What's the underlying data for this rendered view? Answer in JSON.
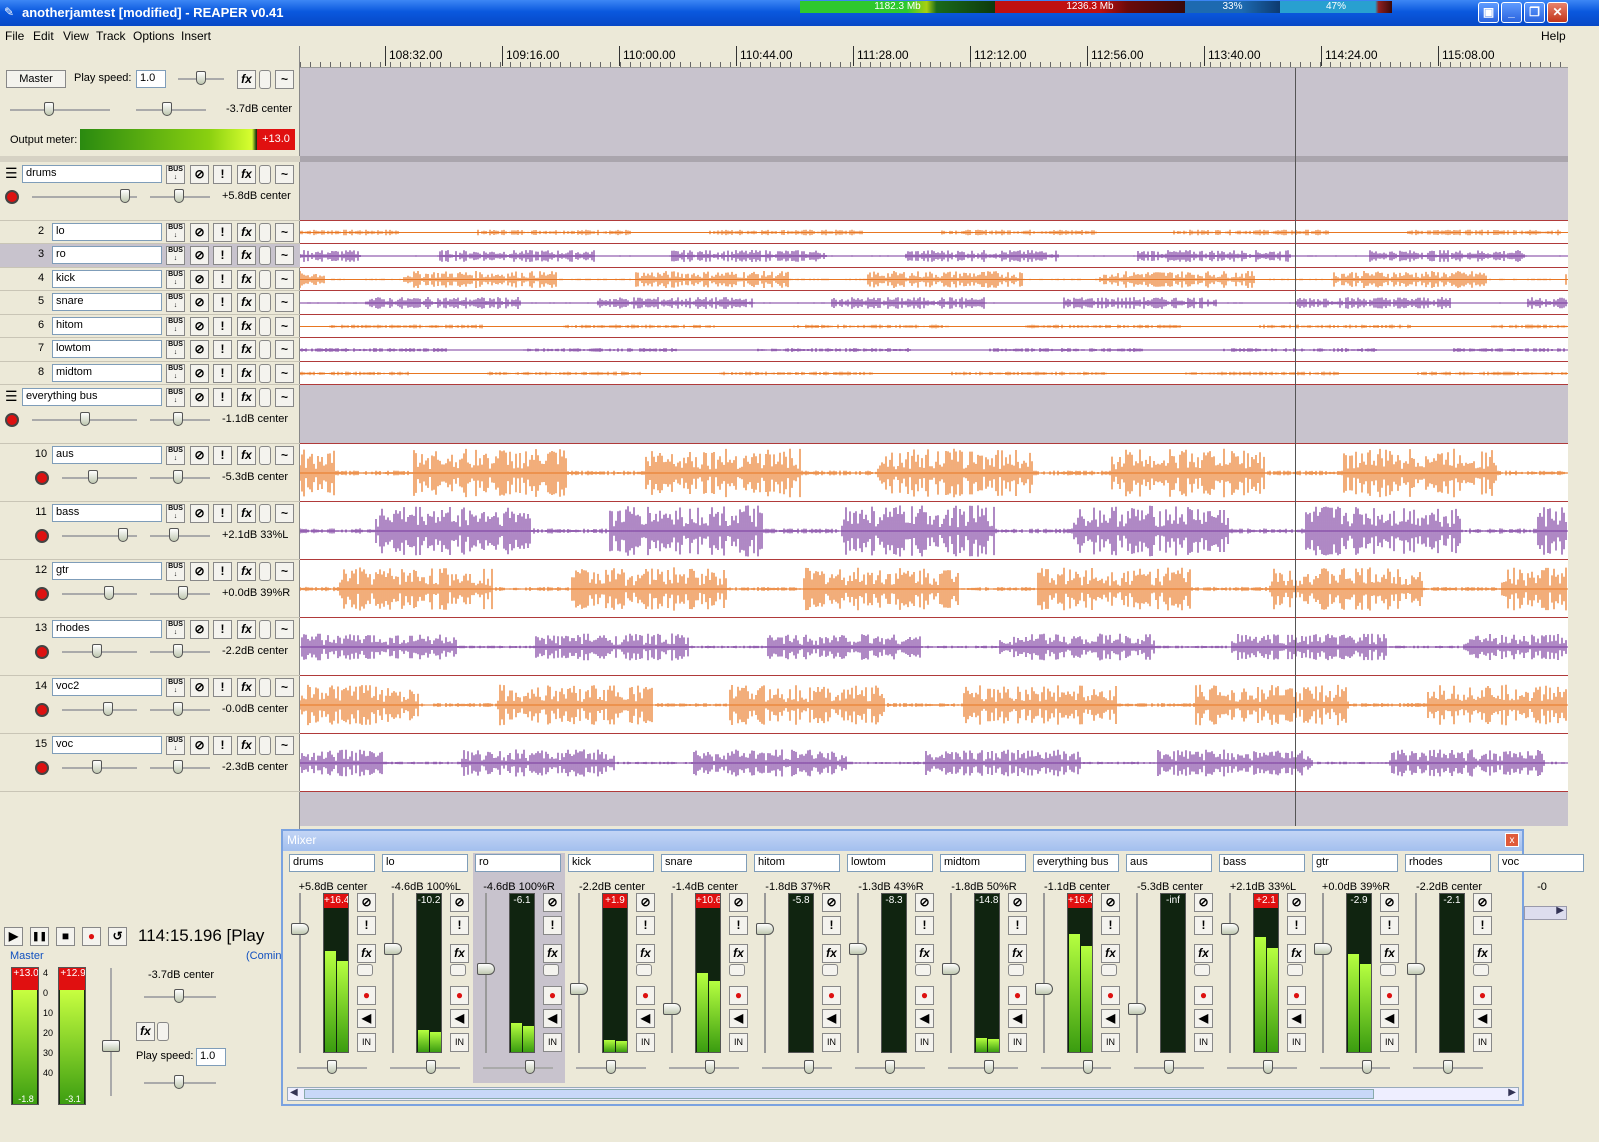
{
  "window": {
    "title": "anotherjamtest [modified] - REAPER v0.41",
    "perf": [
      "1182.3 Mb",
      "1236.3 Mb",
      "33%",
      "47%"
    ],
    "buttons": [
      "▣",
      "_",
      "❐",
      "✕"
    ]
  },
  "menu": {
    "items": [
      "File",
      "Edit",
      "View",
      "Track",
      "Options",
      "Insert"
    ],
    "help": "Help"
  },
  "master": {
    "button": "Master",
    "play_speed_label": "Play speed:",
    "play_speed": "1.0",
    "vol": "-3.7dB center",
    "output_meter_label": "Output meter:",
    "output_peak": "+13.0"
  },
  "icons": {
    "bus": "BUS",
    "mute": "⊘",
    "solo": "!",
    "fx": "fx",
    "env": "~"
  },
  "tracks": [
    {
      "num": "",
      "name": "drums",
      "vol": "+5.8dB center",
      "folder": true
    },
    {
      "num": "2",
      "name": "lo"
    },
    {
      "num": "3",
      "name": "ro"
    },
    {
      "num": "4",
      "name": "kick"
    },
    {
      "num": "5",
      "name": "snare"
    },
    {
      "num": "6",
      "name": "hitom"
    },
    {
      "num": "7",
      "name": "lowtom"
    },
    {
      "num": "8",
      "name": "midtom"
    },
    {
      "num": "",
      "name": "everything bus",
      "vol": "-1.1dB center",
      "folder": true
    },
    {
      "num": "10",
      "name": "aus",
      "vol": "-5.3dB center"
    },
    {
      "num": "11",
      "name": "bass",
      "vol": "+2.1dB 33%L"
    },
    {
      "num": "12",
      "name": "gtr",
      "vol": "+0.0dB 39%R"
    },
    {
      "num": "13",
      "name": "rhodes",
      "vol": "-2.2dB center"
    },
    {
      "num": "14",
      "name": "voc2",
      "vol": "-0.0dB center"
    },
    {
      "num": "15",
      "name": "voc",
      "vol": "-2.3dB center"
    }
  ],
  "ruler": [
    "108:32.00",
    "109:16.00",
    "110:00.00",
    "110:44.00",
    "111:28.00",
    "112:12.00",
    "112:56.00",
    "113:40.00",
    "114:24.00",
    "115:08.00"
  ],
  "mixer": {
    "title": "Mixer",
    "close": "x",
    "strips": [
      {
        "name": "drums",
        "vol": "+5.8dB center",
        "peak": "+16.4",
        "level": 0.7
      },
      {
        "name": "lo",
        "vol": "-4.6dB 100%L",
        "peak": "-10.2",
        "level": 0.15
      },
      {
        "name": "ro",
        "vol": "-4.6dB 100%R",
        "peak": "-6.1",
        "level": 0.2
      },
      {
        "name": "kick",
        "vol": "-2.2dB center",
        "peak": "+1.9",
        "level": 0.08
      },
      {
        "name": "snare",
        "vol": "-1.4dB center",
        "peak": "+10.6",
        "level": 0.55
      },
      {
        "name": "hitom",
        "vol": "-1.8dB 37%R",
        "peak": "-5.8",
        "level": 0.0
      },
      {
        "name": "lowtom",
        "vol": "-1.3dB 43%R",
        "peak": "-8.3",
        "level": 0.0
      },
      {
        "name": "midtom",
        "vol": "-1.8dB 50%R",
        "peak": "-14.8",
        "level": 0.1
      },
      {
        "name": "everything bus",
        "vol": "-1.1dB center",
        "peak": "+16.4",
        "level": 0.82
      },
      {
        "name": "aus",
        "vol": "-5.3dB center",
        "peak": "-inf",
        "level": 0.0
      },
      {
        "name": "bass",
        "vol": "+2.1dB 33%L",
        "peak": "+2.1",
        "level": 0.8
      },
      {
        "name": "gtr",
        "vol": "+0.0dB 39%R",
        "peak": "-2.9",
        "level": 0.68
      },
      {
        "name": "rhodes",
        "vol": "-2.2dB center",
        "peak": "-2.1",
        "level": 0.0
      },
      {
        "name": "voc",
        "vol": "-0",
        "peak": "",
        "level": 0.0
      }
    ],
    "strip_labels": {
      "in": "IN",
      "fx": "fx"
    }
  },
  "transport": {
    "time": "114:15.196 [Play",
    "buttons": [
      "▶",
      "❚❚",
      "■",
      "●",
      "↺"
    ],
    "master_label": "Master",
    "coming": "(Comin",
    "peak_l": "+13.0",
    "peak_r": "+12.9",
    "low_l": "-1.8",
    "low_r": "-3.1",
    "scale": [
      "4",
      "0",
      "10",
      "20",
      "30",
      "40"
    ],
    "vol": "-3.7dB center",
    "play_speed_label": "Play speed:",
    "play_speed": "1.0"
  },
  "colors": {
    "orange": "#e87722",
    "purple": "#7a3a9e",
    "accent": "#0a58de"
  }
}
